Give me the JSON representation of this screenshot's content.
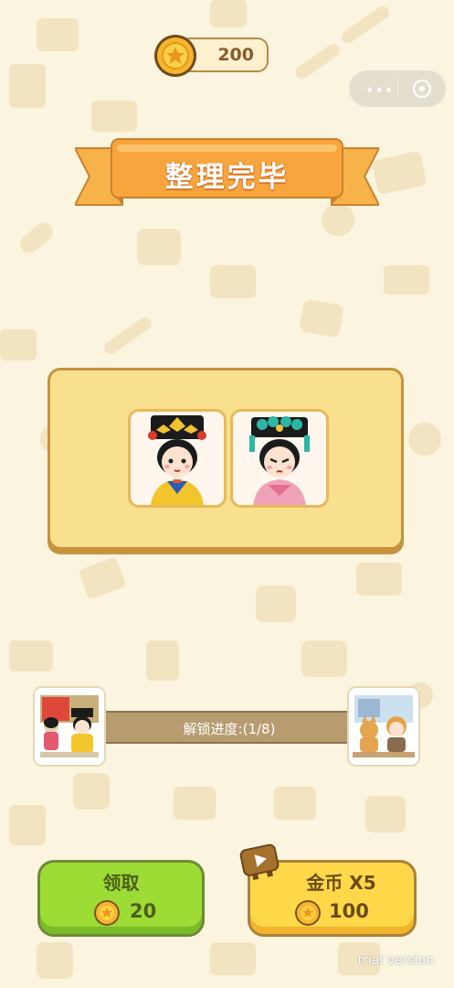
{
  "header": {
    "coins": "200"
  },
  "capsule": {
    "menu_glyph": "•••",
    "close_icon": "target-icon"
  },
  "ribbon": {
    "title": "整理完毕"
  },
  "panel": {
    "cards": [
      {
        "name": "yellow-robed-consort"
      },
      {
        "name": "pink-robed-consort"
      }
    ]
  },
  "progress": {
    "label": "解锁进度:(1/8)",
    "current": 1,
    "total": 8
  },
  "buttons": {
    "claim": {
      "label": "领取",
      "amount": "20"
    },
    "multiply": {
      "label": "金币 X5",
      "amount": "100"
    }
  },
  "watermark": "trial version",
  "colors": {
    "background": "#fbf4de",
    "ribbon": "#f6a540",
    "panel": "#f8e08e",
    "claim": "#9ddc35",
    "multiply": "#ffd84a"
  }
}
